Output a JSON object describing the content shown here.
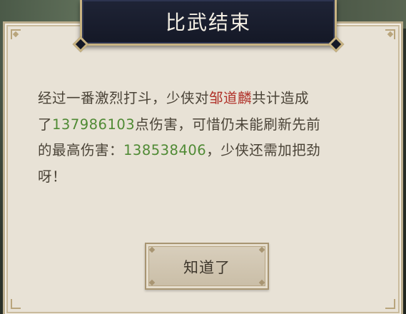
{
  "dialog": {
    "title": "比武结束",
    "message": {
      "line1_prefix": "经过一番激烈打斗，少侠对",
      "opponent_name": "邹道麟",
      "line1_suffix": "共计造成",
      "line2_prefix": "了",
      "damage_dealt": "137986103",
      "line2_suffix": "点伤害，可惜仍未能刷新先前",
      "line3_prefix": "的最高伤害：",
      "best_damage": "138538406",
      "line3_suffix": "，少侠还需加把劲",
      "line4": "呀！"
    },
    "ok_button_label": "知道了"
  },
  "colors": {
    "opponent_name": "#b0322a",
    "damage_numbers": "#4f8a34",
    "body_text": "#4a4337",
    "title_bg": "#1f2436",
    "frame_gold": "#c8b382",
    "parchment": "#e8e2d6"
  }
}
